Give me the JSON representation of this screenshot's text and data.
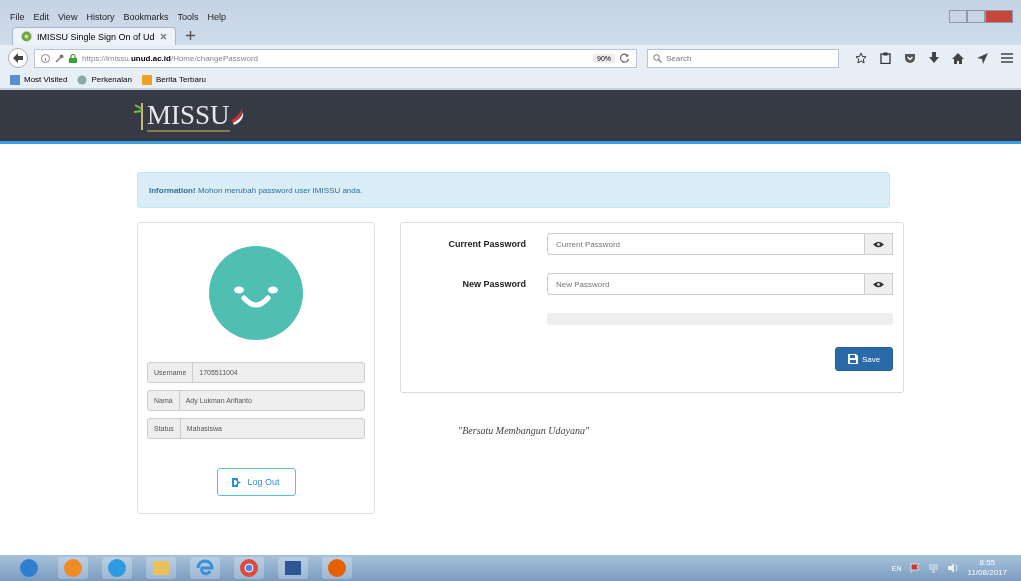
{
  "browser": {
    "menu": [
      "File",
      "Edit",
      "View",
      "History",
      "Bookmarks",
      "Tools",
      "Help"
    ],
    "tabs": [
      {
        "title": "IMISSU Single Sign On of Ud",
        "selected": true
      }
    ],
    "url": {
      "host_pre": "https://imissu.",
      "host": "unud.ac.id",
      "path": "/Home/changePassword"
    },
    "zoom": "90%",
    "search": {
      "placeholder": "Search"
    },
    "bookmarks": [
      {
        "label": "Most Visited",
        "kind": "page"
      },
      {
        "label": "Perkenalan",
        "kind": "globe"
      },
      {
        "label": "Berita Terbaru",
        "kind": "feed"
      }
    ]
  },
  "site": {
    "logo": "MISSU"
  },
  "alert": {
    "title": "Information!",
    "text": "Mohon merubah password user IMISSU anda."
  },
  "profile": {
    "fields": [
      {
        "label": "Username",
        "value": "1705511004"
      },
      {
        "label": "Nama",
        "value": "Ady Lukman Arifianto"
      },
      {
        "label": "Status",
        "value": "Mahasiswa"
      }
    ],
    "logout": "Log Out"
  },
  "form": {
    "fields": [
      {
        "label": "Current Password",
        "placeholder": "Current Password"
      },
      {
        "label": "New Password",
        "placeholder": "New Password"
      }
    ],
    "save": "Save"
  },
  "motto": "\"Bersatu Membangun Udayana\"",
  "taskbar": {
    "apps": [
      {
        "kind": "start"
      },
      {
        "kind": "media"
      },
      {
        "kind": "update"
      },
      {
        "kind": "folder"
      },
      {
        "kind": "ie"
      },
      {
        "kind": "chrome"
      },
      {
        "kind": "word"
      },
      {
        "kind": "firefox"
      }
    ],
    "language": "EN",
    "time": "8:55",
    "date": "11/08/2017"
  }
}
